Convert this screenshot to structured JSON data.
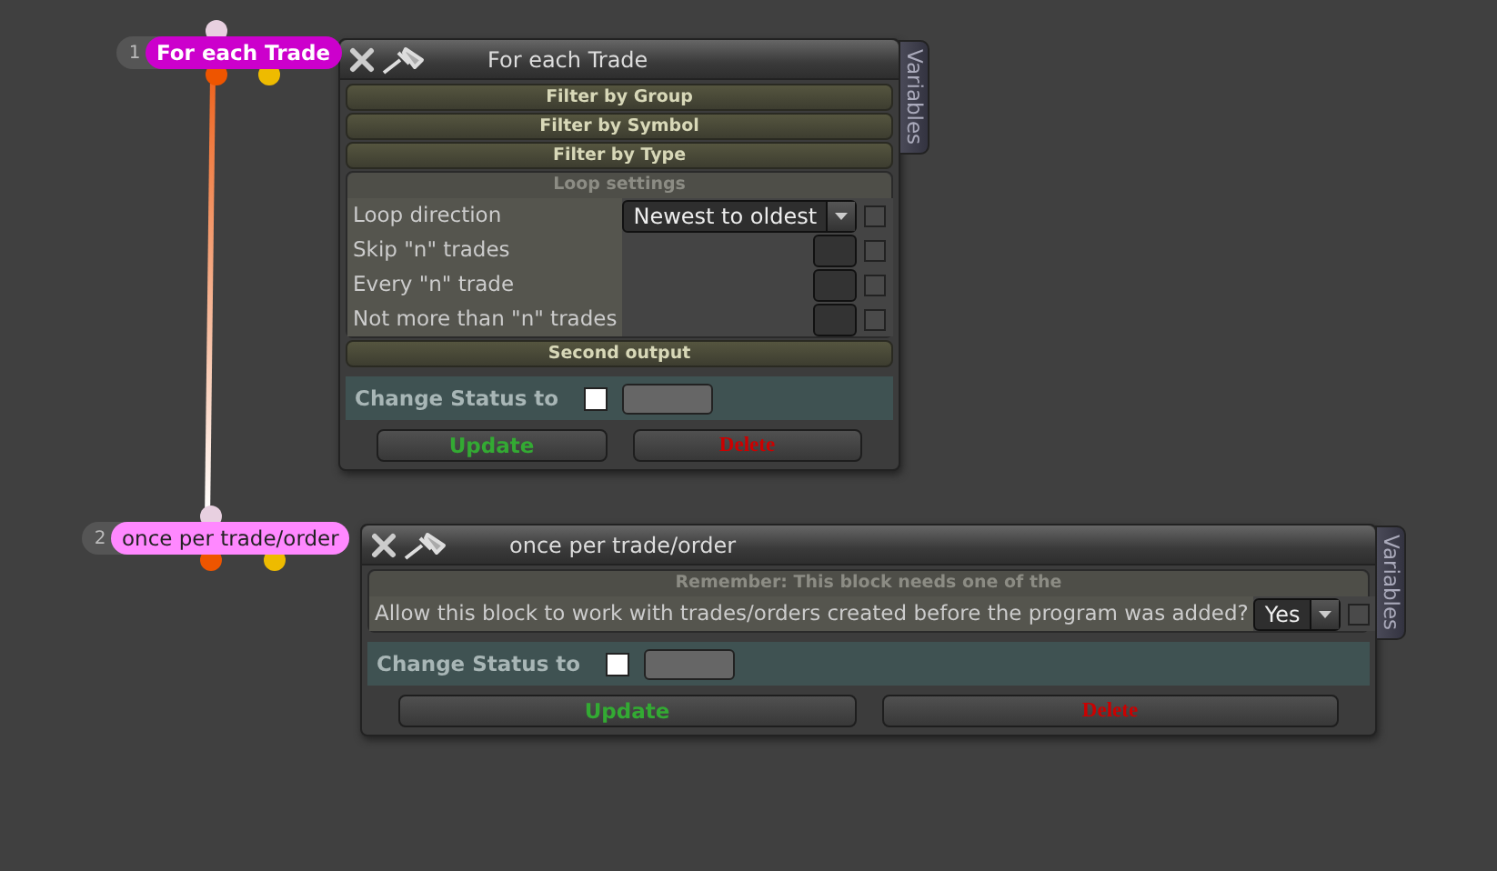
{
  "nodes": [
    {
      "number": "1",
      "label": "For each Trade",
      "selected": true
    },
    {
      "number": "2",
      "label": "once per trade/order",
      "selected": false
    }
  ],
  "panels": [
    {
      "title": "For each Trade",
      "side_tab": "Variables",
      "sections": [
        {
          "kind": "bar",
          "label": "Filter by Group"
        },
        {
          "kind": "bar",
          "label": "Filter by Symbol"
        },
        {
          "kind": "bar",
          "label": "Filter by Type"
        },
        {
          "kind": "group",
          "label": "Loop settings",
          "rows": [
            {
              "kind": "dropdown",
              "label": "Loop direction",
              "value": "Newest to oldest",
              "checked": false
            },
            {
              "kind": "number",
              "label": "Skip \"n\" trades",
              "checked": false
            },
            {
              "kind": "number",
              "label": "Every \"n\" trade",
              "checked": false
            },
            {
              "kind": "number",
              "label": "Not more than \"n\" trades",
              "checked": false
            }
          ]
        },
        {
          "kind": "bar",
          "label": "Second output"
        },
        {
          "kind": "status",
          "label": "Change Status to",
          "checked": false
        }
      ],
      "buttons": [
        {
          "kind": "update",
          "label": "Update"
        },
        {
          "kind": "delete",
          "label": "Delete"
        }
      ]
    },
    {
      "title": "once per trade/order",
      "side_tab": "Variables",
      "sections": [
        {
          "kind": "group",
          "label": "Remember: This block needs one of the",
          "rows": [
            {
              "kind": "dropdown",
              "label": "Allow this block to work with trades/orders created before the program was added?",
              "value": "Yes",
              "checked": false
            }
          ]
        },
        {
          "kind": "status",
          "label": "Change Status to",
          "checked": false
        }
      ],
      "buttons": [
        {
          "kind": "update",
          "label": "Update"
        },
        {
          "kind": "delete",
          "label": "Delete"
        }
      ]
    }
  ]
}
